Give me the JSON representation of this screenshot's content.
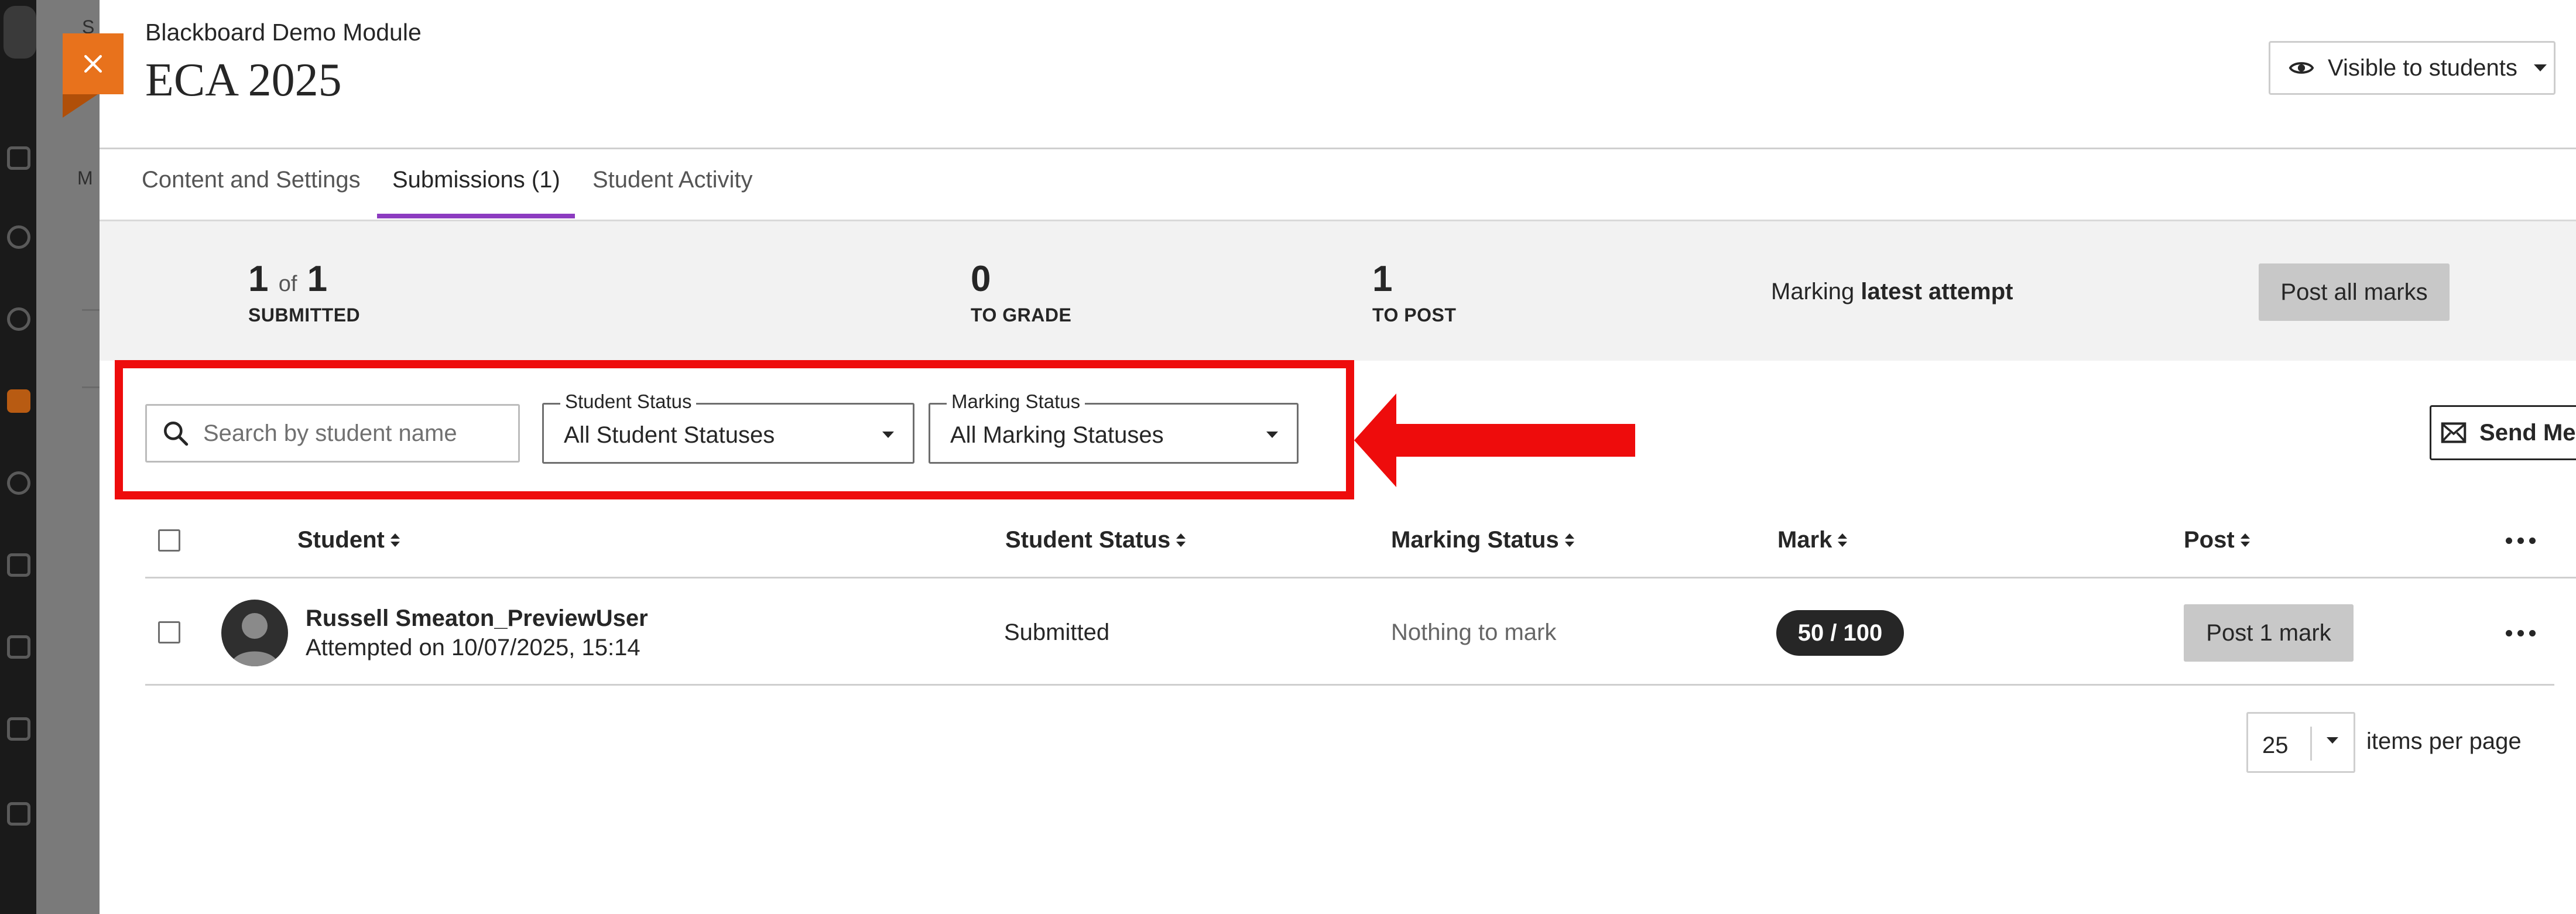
{
  "header": {
    "course_name": "Blackboard Demo Module",
    "title": "ECA 2025",
    "visibility_label": "Visible to students"
  },
  "tabs": [
    {
      "label": "Content and Settings",
      "active": false
    },
    {
      "label": "Submissions (1)",
      "active": true
    },
    {
      "label": "Student Activity",
      "active": false
    }
  ],
  "stats": {
    "submitted": {
      "count": "1",
      "of": "of",
      "total": "1",
      "label": "SUBMITTED"
    },
    "to_grade": {
      "count": "0",
      "label": "TO GRADE"
    },
    "to_post": {
      "count": "1",
      "label": "TO POST"
    },
    "marking_prefix": "Marking",
    "marking_strong": "latest attempt",
    "post_all_label": "Post all marks"
  },
  "filters": {
    "search_placeholder": "Search by student name",
    "student_status": {
      "label": "Student Status",
      "value": "All Student Statuses"
    },
    "marking_status": {
      "label": "Marking Status",
      "value": "All Marking Statuses"
    },
    "send_message_label": "Send Message"
  },
  "table": {
    "columns": [
      "Student",
      "Student Status",
      "Marking Status",
      "Mark",
      "Post"
    ],
    "rows": [
      {
        "name": "Russell Smeaton_PreviewUser",
        "attempted": "Attempted on 10/07/2025, 15:14",
        "student_status": "Submitted",
        "marking_status": "Nothing to mark",
        "mark": "50",
        "mark_sep": " / 100",
        "post_label": "Post 1 mark"
      }
    ]
  },
  "pagination": {
    "page_size": "25",
    "items_label": "items per page"
  },
  "colors": {
    "accent_purple": "#8c3bc0",
    "close_orange": "#e8721c",
    "highlight_red": "#ee0c0c"
  }
}
